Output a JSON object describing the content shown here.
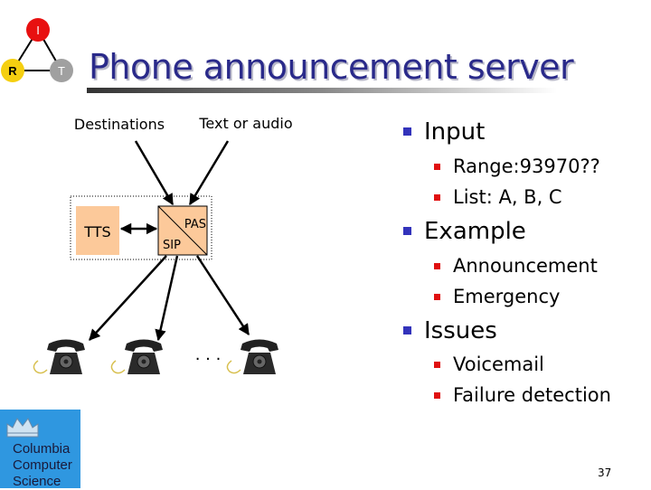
{
  "slide": {
    "title": "Phone announcement server",
    "page_number": "37",
    "logo_irt": {
      "top": "I",
      "left": "R",
      "right": "T"
    },
    "logo_columbia": {
      "line1": "Columbia",
      "line2": "Computer",
      "line3": "Science"
    }
  },
  "diagram": {
    "input_destinations": "Destinations",
    "input_text_audio": "Text or audio",
    "tts_label": "TTS",
    "pas_label": "PAS",
    "sip_label": "SIP",
    "ellipsis": ". . .",
    "phone_count": 3
  },
  "bullets": [
    {
      "label": "Input",
      "items": [
        "Range:93970??",
        "List: A, B, C"
      ]
    },
    {
      "label": "Example",
      "items": [
        "Announcement",
        "Emergency"
      ]
    },
    {
      "label": "Issues",
      "items": [
        "Voicemail",
        "Failure detection"
      ]
    }
  ],
  "colors": {
    "title": "#2a2a8a",
    "bullet_l1": "#3333bb",
    "bullet_l2": "#e01010",
    "box_fill": "#fcc99a",
    "columbia_blue": "#2f97e0"
  }
}
